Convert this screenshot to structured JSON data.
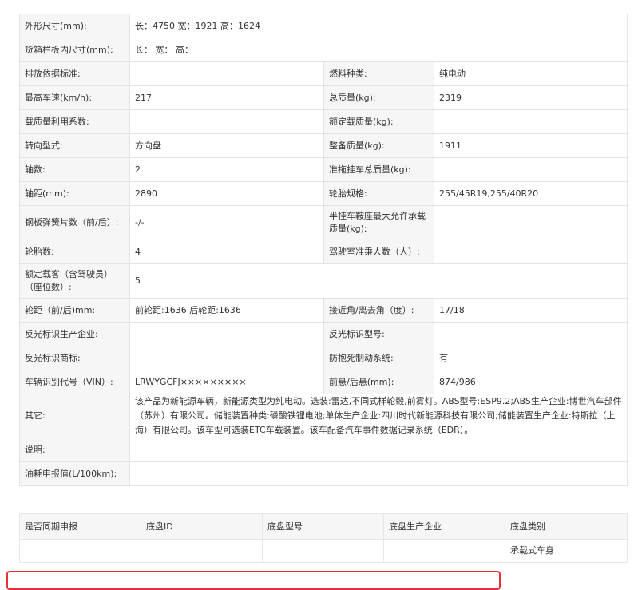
{
  "spec": {
    "dimensions_label": "外形尺寸(mm):",
    "dimensions_value": "长：4750 宽：1921 高：1624",
    "cargo_label": "货箱栏板内尺寸(mm):",
    "cargo_value": "长：  宽：  高：",
    "emission_label": "排放依据标准:",
    "emission_value": "",
    "fuel_label": "燃料种类:",
    "fuel_value": "纯电动",
    "top_speed_label": "最高车速(km/h):",
    "top_speed_value": "217",
    "total_mass_label": "总质量(kg):",
    "total_mass_value": "2319",
    "load_util_label": "载质量利用系数:",
    "load_util_value": "",
    "rated_load_label": "额定载质量(kg):",
    "rated_load_value": "",
    "steering_label": "转向型式:",
    "steering_value": "方向盘",
    "curb_mass_label": "整备质量(kg):",
    "curb_mass_value": "1911",
    "axles_label": "轴数:",
    "axles_value": "2",
    "trailer_mass_label": "准拖挂车总质量(kg):",
    "trailer_mass_value": "",
    "wheelbase_label": "轴距(mm):",
    "wheelbase_value": "2890",
    "tire_spec_label": "轮胎规格:",
    "tire_spec_value": "255/45R19,255/40R20",
    "leaf_spring_label": "钢板弹簧片数（前/后）:",
    "leaf_spring_value": "-/-",
    "saddle_label": "半挂车鞍座最大允许承载质量(kg):",
    "saddle_value": "",
    "tire_count_label": "轮胎数:",
    "tire_count_value": "4",
    "cab_seats_label": "驾驶室准乘人数（人）:",
    "cab_seats_value": "",
    "passengers_label": "额定载客（含驾驶员）（座位数）:",
    "passengers_value": "5",
    "track_label": "轮距（前/后)mm:",
    "track_value": "前轮距:1636 后轮距:1636",
    "angle_label": "接近角/离去角（度）:",
    "angle_value": "17/18",
    "reflector_maker_label": "反光标识生产企业:",
    "reflector_maker_value": "",
    "reflector_model_label": "反光标识型号:",
    "reflector_model_value": "",
    "reflector_brand_label": "反光标识商标:",
    "reflector_brand_value": "",
    "abs_label": "防抱死制动系统:",
    "abs_value": "有",
    "vin_label": "车辆识别代号（VIN）:",
    "vin_value": "LRWYGCFJ×××××××××",
    "overhang_label": "前悬/后悬(mm):",
    "overhang_value": "874/986",
    "other_label": "其它:",
    "other_value": "该产品为新能源车辆，新能源类型为纯电动。选装:雷达,不同式样轮毂,前雾灯。ABS型号:ESP9.2;ABS生产企业:博世汽车部件（苏州）有限公司。储能装置种类:磷酸铁锂电池;单体生产企业:四川时代新能源科技有限公司;储能装置生产企业:特斯拉（上海）有限公司。该车型可选装ETC车载装置。该车配备汽车事件数据记录系统（EDR）。",
    "note_label": "说明:",
    "note_value": "",
    "fuel_consumption_label": "油耗申报值(L/100km):",
    "fuel_consumption_value": ""
  },
  "chassis": {
    "headers": [
      "是否同期申报",
      "底盘ID",
      "底盘型号",
      "底盘生产企业",
      "底盘类别"
    ],
    "row": [
      "",
      "",
      "",
      "",
      "承载式车身"
    ]
  },
  "colors": {
    "highlight_border": "#e2333a",
    "label_bg": "#f6f6f6",
    "grid": "#e3e3e3"
  }
}
